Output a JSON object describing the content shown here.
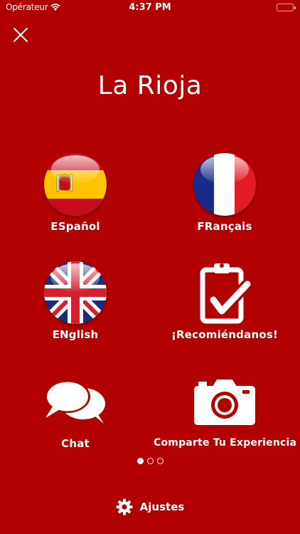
{
  "status_bar": {
    "carrier": "Opérateur",
    "time": "4:37 PM"
  },
  "app": {
    "title": "La Rioja"
  },
  "tiles": [
    {
      "id": "es",
      "label": "ESpañol",
      "icon": "spain-flag-icon"
    },
    {
      "id": "fr",
      "label": "FRançais",
      "icon": "france-flag-icon"
    },
    {
      "id": "en",
      "label": "ENglish",
      "icon": "uk-flag-icon"
    },
    {
      "id": "rec",
      "label": "¡Recomiéndanos!",
      "icon": "clipboard-check-icon"
    },
    {
      "id": "chat",
      "label": "Chat",
      "icon": "chat-bubbles-icon"
    },
    {
      "id": "share",
      "label": "Comparte Tu Experiencia",
      "icon": "camera-icon"
    }
  ],
  "pagination": {
    "count": 3,
    "active": 1
  },
  "footer": {
    "settings_label": "Ajustes",
    "icon": "gear-icon"
  },
  "colors": {
    "background": "#b10100",
    "foreground": "#ffffff"
  }
}
